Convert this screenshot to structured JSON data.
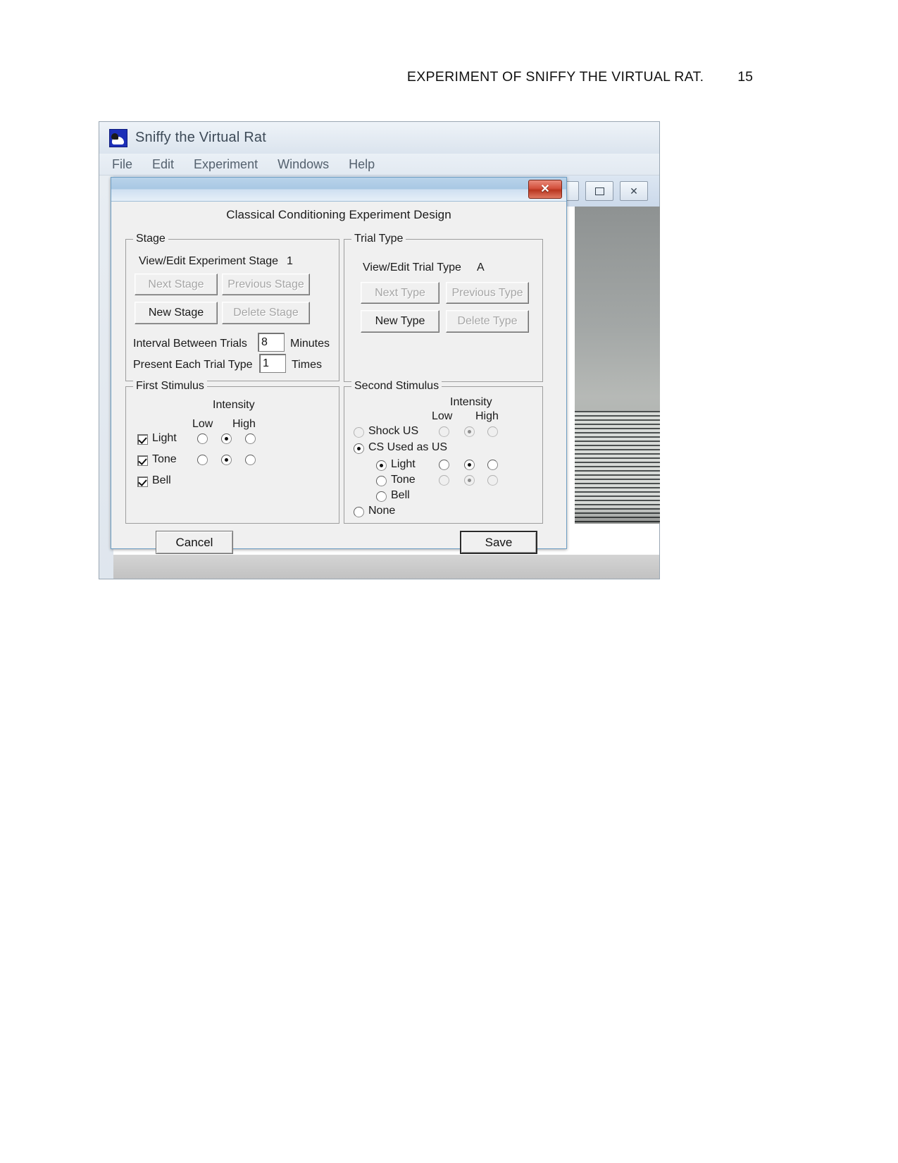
{
  "document": {
    "running_head": "EXPERIMENT OF SNIFFY THE VIRTUAL RAT.",
    "page_number": "15"
  },
  "app": {
    "title": "Sniffy the Virtual Rat",
    "icon": "sniffy-rat-icon",
    "menu": [
      {
        "label": "File"
      },
      {
        "label": "Edit"
      },
      {
        "label": "Experiment"
      },
      {
        "label": "Windows"
      },
      {
        "label": "Help"
      }
    ],
    "mdi_buttons": [
      {
        "name": "restore-window-button",
        "label": ""
      },
      {
        "name": "maximize-window-button",
        "label": ""
      },
      {
        "name": "close-window-button",
        "label": "✕"
      }
    ]
  },
  "dialog": {
    "close_label": "✕",
    "heading": "Classical Conditioning Experiment Design",
    "stage": {
      "legend": "Stage",
      "viewedit_label": "View/Edit Experiment Stage",
      "viewedit_value": "1",
      "buttons": [
        {
          "label": "Next Stage",
          "enabled": false
        },
        {
          "label": "Previous Stage",
          "enabled": false
        },
        {
          "label": "New Stage",
          "enabled": true
        },
        {
          "label": "Delete Stage",
          "enabled": false
        }
      ],
      "interval_label": "Interval Between Trials",
      "interval_value": "8",
      "interval_unit": "Minutes",
      "present_label": "Present Each Trial Type",
      "present_value": "1",
      "present_unit": "Times"
    },
    "trial_type": {
      "legend": "Trial Type",
      "viewedit_label": "View/Edit Trial Type",
      "viewedit_value": "A",
      "buttons": [
        {
          "label": "Next Type",
          "enabled": false
        },
        {
          "label": "Previous Type",
          "enabled": false
        },
        {
          "label": "New Type",
          "enabled": true
        },
        {
          "label": "Delete Type",
          "enabled": false
        }
      ]
    },
    "first_stimulus": {
      "legend": "First Stimulus",
      "intensity_title": "Intensity",
      "low_label": "Low",
      "high_label": "High",
      "items": [
        {
          "label": "Light",
          "checked": true,
          "has_intensity": true,
          "intensity": "mid"
        },
        {
          "label": "Tone",
          "checked": true,
          "has_intensity": true,
          "intensity": "mid"
        },
        {
          "label": "Bell",
          "checked": true,
          "has_intensity": false,
          "intensity": ""
        }
      ]
    },
    "second_stimulus": {
      "legend": "Second Stimulus",
      "intensity_title": "Intensity",
      "low_label": "Low",
      "high_label": "High",
      "shock_label": "Shock US",
      "shock_selected": false,
      "cs_label": "CS Used as US",
      "cs_selected": true,
      "cs_options": [
        {
          "label": "Light",
          "selected": true
        },
        {
          "label": "Tone",
          "selected": false
        },
        {
          "label": "Bell",
          "selected": false
        }
      ],
      "none_label": "None",
      "none_selected": false
    },
    "cancel_label": "Cancel",
    "save_label": "Save"
  },
  "colors": {
    "dialog_face": "#f0f0f0",
    "title_blue": "#a9c8e4",
    "close_red": "#d2503c"
  }
}
